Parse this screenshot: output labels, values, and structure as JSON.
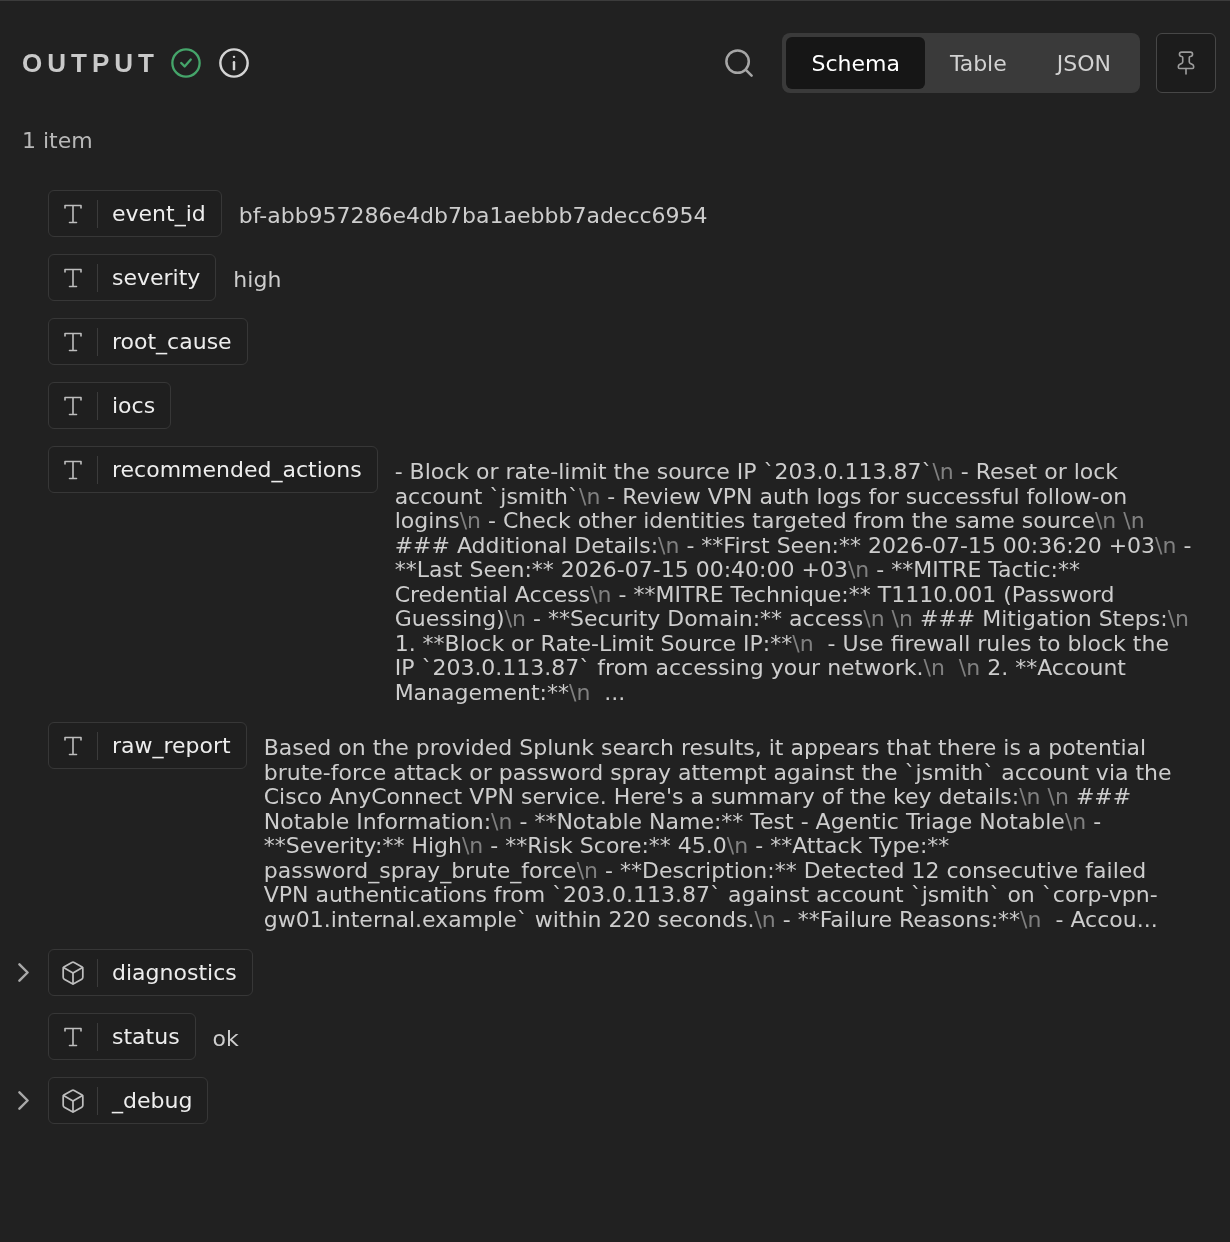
{
  "header": {
    "title": "OUTPUT"
  },
  "view_tabs": [
    {
      "label": "Schema",
      "selected": true
    },
    {
      "label": "Table",
      "selected": false
    },
    {
      "label": "JSON",
      "selected": false
    }
  ],
  "item_count": "1 item",
  "fields": [
    {
      "kind": "string",
      "name": "event_id",
      "value": "bf-abb957286e4db7ba1aebbb7adecc6954"
    },
    {
      "kind": "string",
      "name": "severity",
      "value": "high"
    },
    {
      "kind": "string",
      "name": "root_cause"
    },
    {
      "kind": "string",
      "name": "iocs"
    },
    {
      "kind": "string",
      "name": "recommended_actions",
      "value": "- Block or rate-limit the source IP `203.0.113.87`\\n - Reset or lock account `jsmith`\\n - Review VPN auth logs for successful follow-on logins\\n - Check other identities targeted from the same source\\n \\n ### Additional Details:\\n - **First Seen:** 2026-07-15 00:36:20 +03\\n - **Last Seen:** 2026-07-15 00:40:00 +03\\n - **MITRE Tactic:** Credential Access\\n - **MITRE Technique:** T1110.001 (Password Guessing)\\n - **Security Domain:** access\\n \\n ### Mitigation Steps:\\n 1. **Block or Rate-Limit Source IP:**\\n  - Use firewall rules to block the IP `203.0.113.87` from accessing your network.\\n  \\n 2. **Account Management:**\\n  ..."
    },
    {
      "kind": "string",
      "name": "raw_report",
      "value": "Based on the provided Splunk search results, it appears that there is a potential brute-force attack or password spray attempt against the `jsmith` account via the Cisco AnyConnect VPN service. Here's a summary of the key details:\\n \\n ### Notable Information:\\n - **Notable Name:** Test - Agentic Triage Notable\\n - **Severity:** High\\n - **Risk Score:** 45.0\\n - **Attack Type:** password_spray_brute_force\\n - **Description:** Detected 12 consecutive failed VPN authentications from `203.0.113.87` against account `jsmith` on `corp-vpn-gw01.internal.example` within 220 seconds.\\n - **Failure Reasons:**\\n  - Accou..."
    },
    {
      "kind": "object",
      "name": "diagnostics",
      "expanded": false
    },
    {
      "kind": "string",
      "name": "status",
      "value": "ok"
    },
    {
      "kind": "object",
      "name": "_debug",
      "expanded": false
    }
  ]
}
